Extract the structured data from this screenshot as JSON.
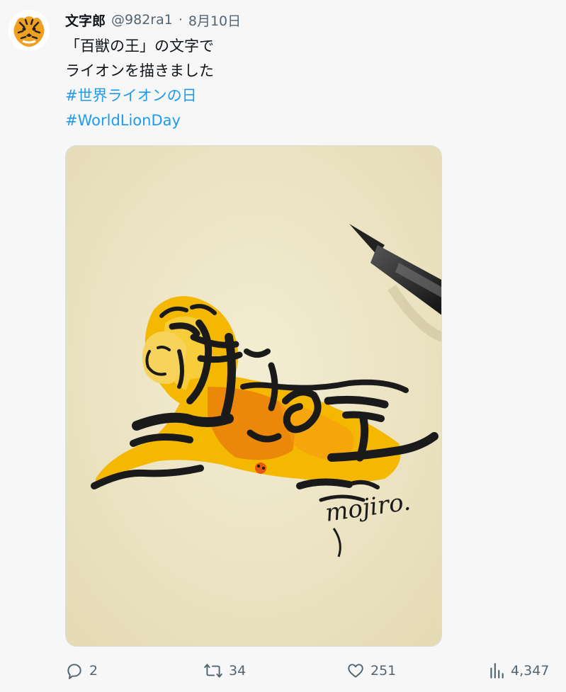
{
  "tweet": {
    "author": {
      "display_name": "文字郎",
      "handle": "@982ra1",
      "separator": "·",
      "date": "8月10日",
      "avatar_icon": "tiger-avatar"
    },
    "text_lines": [
      "「百獣の王」の文字で",
      "ライオンを描きました"
    ],
    "hashtags": [
      "#世界ライオンの日",
      "#WorldLionDay"
    ],
    "media": {
      "signature": "mojiro."
    },
    "actions": {
      "replies": "2",
      "retweets": "34",
      "likes": "251",
      "views": "4,347"
    }
  },
  "colors": {
    "hashtag": "#1d9bf0",
    "secondary_text": "#536471",
    "lion_yellow": "#f5b800",
    "lion_orange": "#e8780c",
    "ink": "#1a1a1a",
    "paper": "#efe8c9"
  }
}
